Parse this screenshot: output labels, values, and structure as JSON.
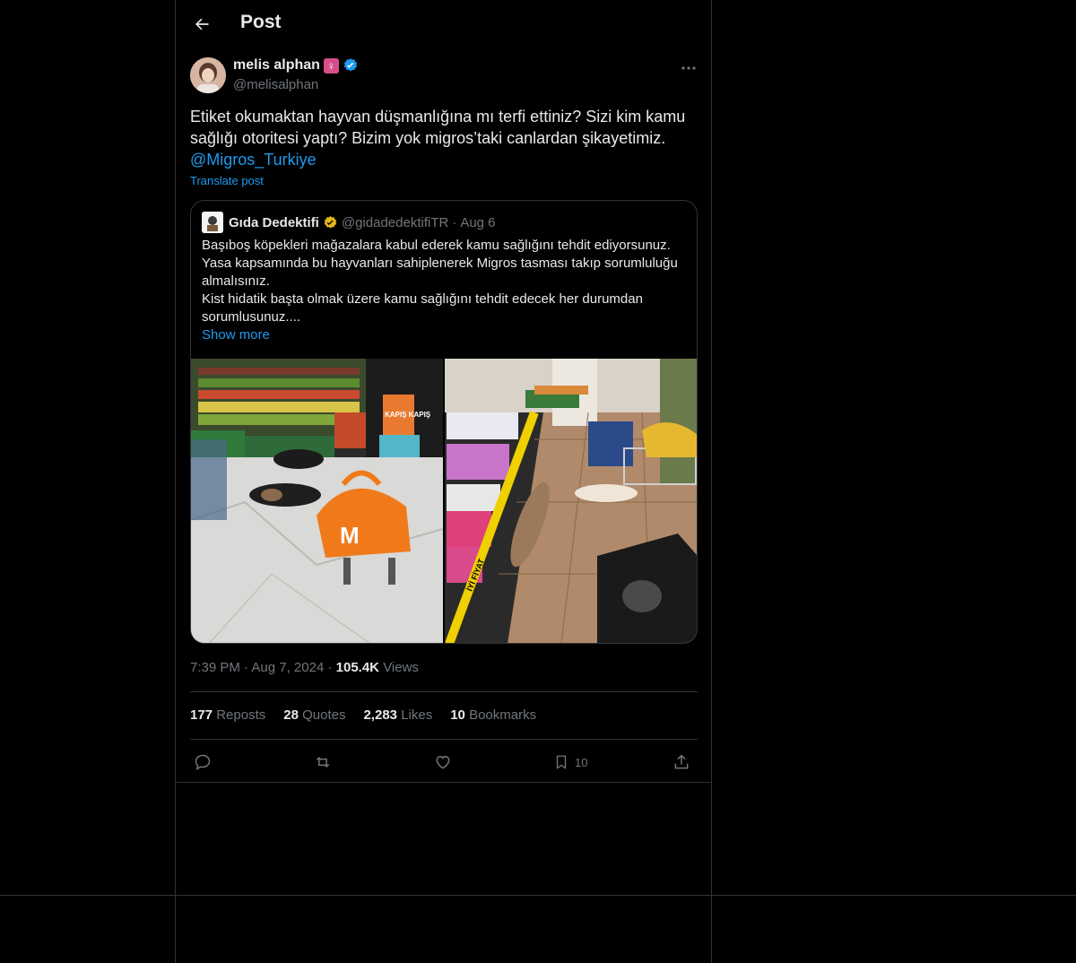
{
  "header": {
    "title": "Post",
    "back_icon": "arrow-left-icon"
  },
  "author": {
    "name": "melis alphan",
    "emoji": "♀",
    "handle": "@melisalphan",
    "verified": true,
    "verified_color": "#1d9bf0"
  },
  "post": {
    "text_line1": "Etiket okumaktan hayvan düşmanlığına mı terfi ettiniz? Sizi kim kamu sağlığı otoritesi yaptı? Bizim yok migros’taki canlardan şikayetimiz.",
    "mention": "@Migros_Turkiye",
    "translate_label": "Translate post"
  },
  "quoted": {
    "name": "Gıda Dedektifi",
    "handle": "@gidadedektifiTR",
    "date": "Aug 6",
    "dot": "·",
    "text": "Başıboş köpekleri mağazalara kabul ederek kamu sağlığını tehdit ediyorsunuz. Yasa kapsamında bu hayvanları sahiplenerek Migros tasması takıp sorumluluğu almalısınız.\nKist hidatik başta olmak üzere kamu sağlığını tehdit edecek her durumdan sorumlusunuz....",
    "show_more": "Show more",
    "verified_color": "#e2b719",
    "image1_sign_text": "KAPIŞ KAPIŞ",
    "image1_bag_text": "M",
    "image2_sign_text": "İYİ FİYAT"
  },
  "meta": {
    "time": "7:39 PM",
    "date": "Aug 7, 2024",
    "dot": "·",
    "views_count": "105.4K",
    "views_label": "Views"
  },
  "stats": {
    "reposts_count": "177",
    "reposts_label": "Reposts",
    "quotes_count": "28",
    "quotes_label": "Quotes",
    "likes_count": "2,283",
    "likes_label": "Likes",
    "bookmarks_count": "10",
    "bookmarks_label": "Bookmarks"
  },
  "actions": {
    "reply_icon": "reply-icon",
    "repost_icon": "repost-icon",
    "like_icon": "heart-icon",
    "bookmark_icon": "bookmark-icon",
    "bookmark_count": "10",
    "share_icon": "share-icon"
  }
}
